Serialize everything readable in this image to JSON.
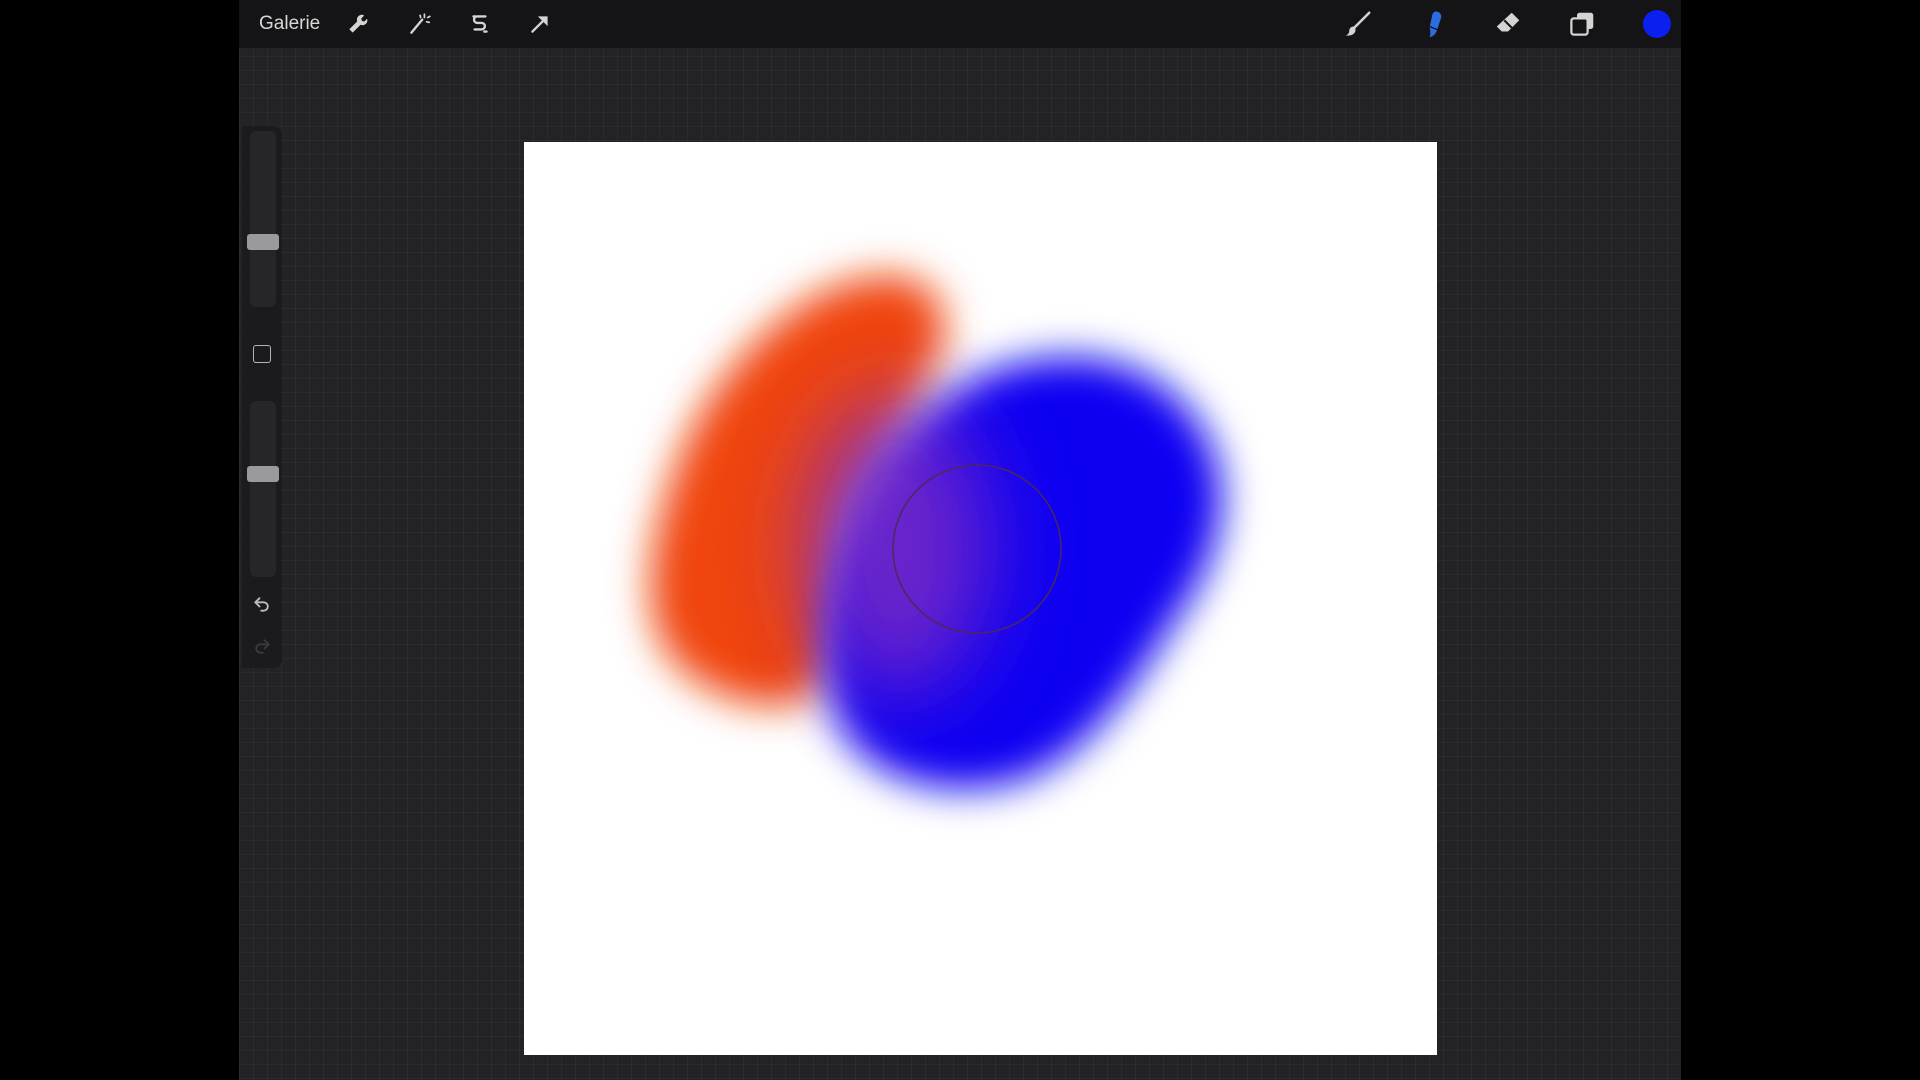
{
  "toolbar": {
    "gallery_label": "Galerie",
    "left_icons": [
      "wrench-icon",
      "magic-wand-icon",
      "selection-s-icon",
      "arrow-cursor-icon"
    ],
    "right_icons": [
      "brush-icon",
      "smudge-icon",
      "eraser-icon",
      "layers-icon"
    ],
    "active_tool": "smudge",
    "active_tool_color": "#2b6de0",
    "current_color": "#0b1ff0"
  },
  "sidebar": {
    "brush_size_level": 0.35,
    "opacity_level": 0.6
  },
  "canvas": {
    "background": "#ffffff",
    "paint_colors": {
      "orange": "#f0440c",
      "blue": "#0a06f2",
      "purple_blend": "#7a2cc4"
    }
  },
  "colors": {
    "app_bg": "#232325",
    "topbar_bg": "#141416",
    "sidebar_bg": "#1b1b1d"
  }
}
